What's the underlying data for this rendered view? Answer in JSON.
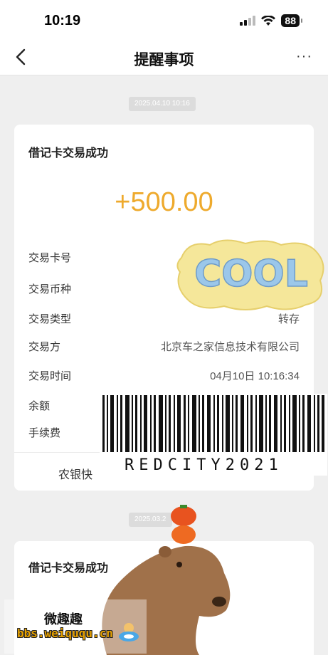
{
  "status_bar": {
    "time": "10:19",
    "battery": "88"
  },
  "nav": {
    "title": "提醒事项",
    "more": "···"
  },
  "messages": [
    {
      "date": "2025.04.10 10:16",
      "title": "借记卡交易成功",
      "amount": "+500.00",
      "rows": [
        {
          "label": "交易卡号",
          "value": ""
        },
        {
          "label": "交易币种",
          "value": ""
        },
        {
          "label": "交易类型",
          "value": "转存"
        },
        {
          "label": "交易方",
          "value": "北京车之家信息技术有限公司"
        },
        {
          "label": "交易时间",
          "value": "04月10日 10:16:34"
        },
        {
          "label": "余额",
          "value": ""
        },
        {
          "label": "手续费",
          "value": ""
        }
      ],
      "footer": "农银快"
    },
    {
      "date": "2025.03.2",
      "title": "借记卡交易成功"
    }
  ],
  "stickers": {
    "cool": "COOL",
    "barcode_text": "REDCITY2021",
    "watermark_line1": "微趣趣",
    "watermark_line2": "bbs.weiququ.cn"
  },
  "colors": {
    "amount": "#eeaa2d",
    "background": "#efefef"
  }
}
